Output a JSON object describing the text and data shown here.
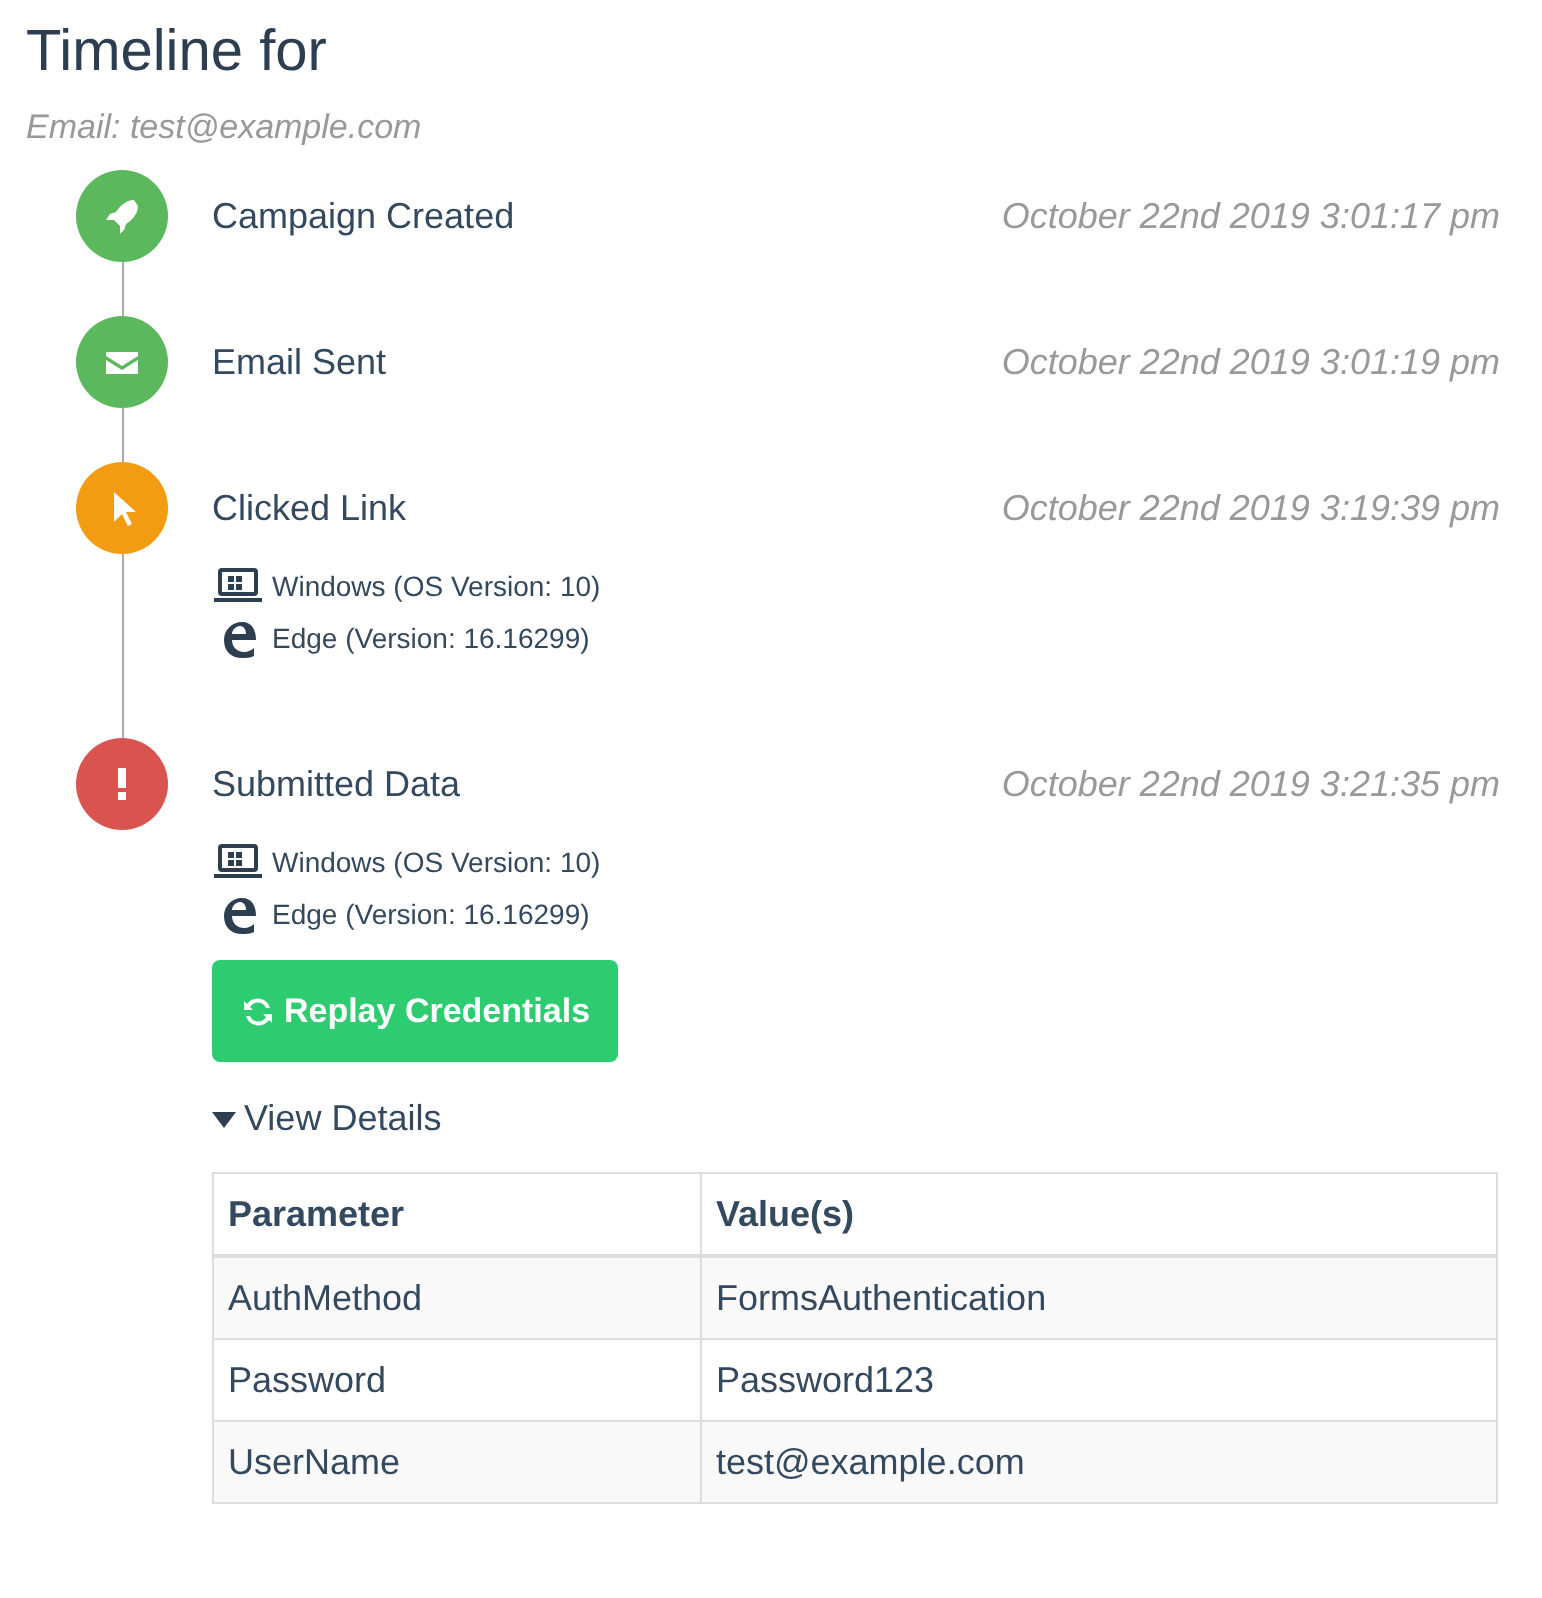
{
  "title": "Timeline for",
  "subtitle": "Email: test@example.com",
  "events": [
    {
      "kind": "rocket",
      "color": "#5cb85c",
      "label": "Campaign Created",
      "time": "October 22nd 2019 3:01:17 pm"
    },
    {
      "kind": "envelope",
      "color": "#5cb85c",
      "label": "Email Sent",
      "time": "October 22nd 2019 3:01:19 pm"
    },
    {
      "kind": "pointer",
      "color": "#f39c12",
      "label": "Clicked Link",
      "time": "October 22nd 2019 3:19:39 pm",
      "os": "Windows (OS Version: 10)",
      "browser": "Edge (Version: 16.16299)"
    },
    {
      "kind": "alert",
      "color": "#d9534f",
      "label": "Submitted Data",
      "time": "October 22nd 2019 3:21:35 pm",
      "os": "Windows (OS Version: 10)",
      "browser": "Edge (Version: 16.16299)",
      "action": "Replay Credentials",
      "details": {
        "toggle": "View Details",
        "expanded": true,
        "columns": [
          "Parameter",
          "Value(s)"
        ],
        "rows": [
          [
            "AuthMethod",
            "FormsAuthentication"
          ],
          [
            "Password",
            "Password123"
          ],
          [
            "UserName",
            "test@example.com"
          ]
        ]
      }
    }
  ]
}
